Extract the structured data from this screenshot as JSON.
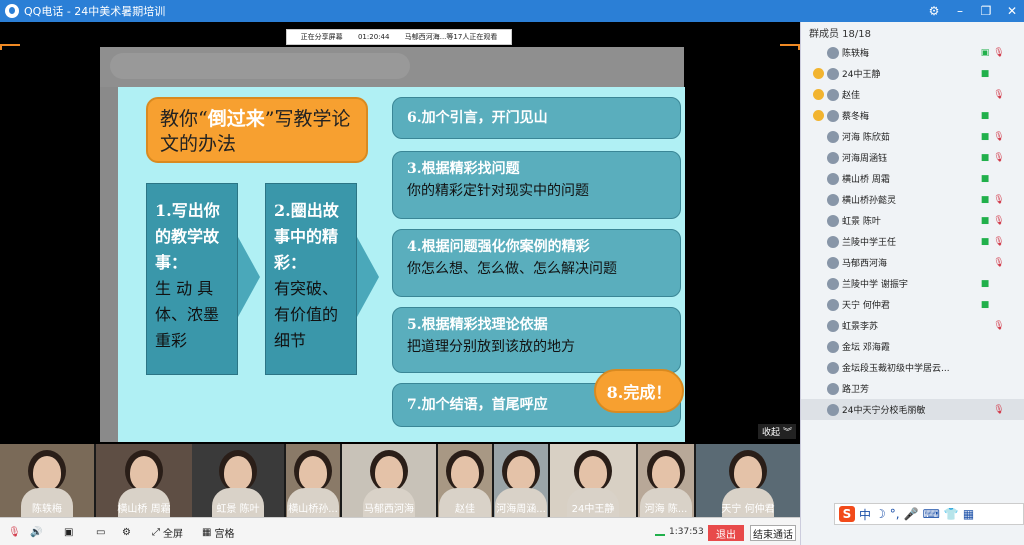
{
  "window": {
    "title": "QQ电话 - 24中美术暑期培训"
  },
  "share_bar": {
    "label": "正在分享屏幕",
    "time": "01:20:44",
    "watchers": "马郁西河海...等17人正在观看"
  },
  "slide": {
    "heading_pre": "教你“",
    "heading_hl": "倒过来",
    "heading_post": "”写教学论文的办法",
    "box1_title": "1.写出你的教学故事：",
    "box1_sub": "生 动 具 体、浓墨重彩",
    "box2_title": "2.圈出故事中的精彩：",
    "box2_sub": "有突破、有价值的细节",
    "item6": "6.加个引言，开门见山",
    "item3_title": "3.根据精彩找问题",
    "item3_sub": "你的精彩定针对现实中的问题",
    "item4_title": "4.根据问题强化你案例的精彩",
    "item4_sub": "你怎么想、怎么做、怎么解决问题",
    "item5_title": "5.根据精彩找理论依据",
    "item5_sub": "把道理分别放到该放的地方",
    "item7": "7.加个结语，首尾呼应",
    "item8": "8.完成！"
  },
  "collapse_label": "收起",
  "panel": {
    "header": "群成员 18/18",
    "members": [
      {
        "name": "陈轶梅"
      },
      {
        "name": "24中王静"
      },
      {
        "name": "赵佳"
      },
      {
        "name": "蔡冬梅"
      },
      {
        "name": "河海 陈欣茹"
      },
      {
        "name": "河海周涵钰"
      },
      {
        "name": "横山桥 周霜"
      },
      {
        "name": "横山桥孙懿灵"
      },
      {
        "name": "虹景 陈叶"
      },
      {
        "name": "兰陵中学王任"
      },
      {
        "name": "马郁西河海"
      },
      {
        "name": "兰陵中学 谢振宇"
      },
      {
        "name": "天宁 何仲君"
      },
      {
        "name": "虹景李苏"
      },
      {
        "name": "金坛 邓海霞"
      },
      {
        "name": "金坛段玉裁初级中学居云..."
      },
      {
        "name": "路卫芳"
      },
      {
        "name": "24中天宁分校毛丽敏"
      }
    ]
  },
  "thumbs": [
    {
      "label": "陈轶梅"
    },
    {
      "label": "横山桥 周霜"
    },
    {
      "label": "虹景 陈叶"
    },
    {
      "label": "横山桥孙..."
    },
    {
      "label": "马郁西河海"
    },
    {
      "label": "赵佳"
    },
    {
      "label": "河海周涵..."
    },
    {
      "label": "24中王静"
    },
    {
      "label": "河海 陈..."
    },
    {
      "label": "天宁 何仲君"
    }
  ],
  "toolbar": {
    "fullscreen": "全屏",
    "grid": "宫格",
    "timer": "1:37:53",
    "exit": "退出",
    "end": "结束通话"
  },
  "ime": {
    "logo": "S",
    "mode": "中"
  }
}
